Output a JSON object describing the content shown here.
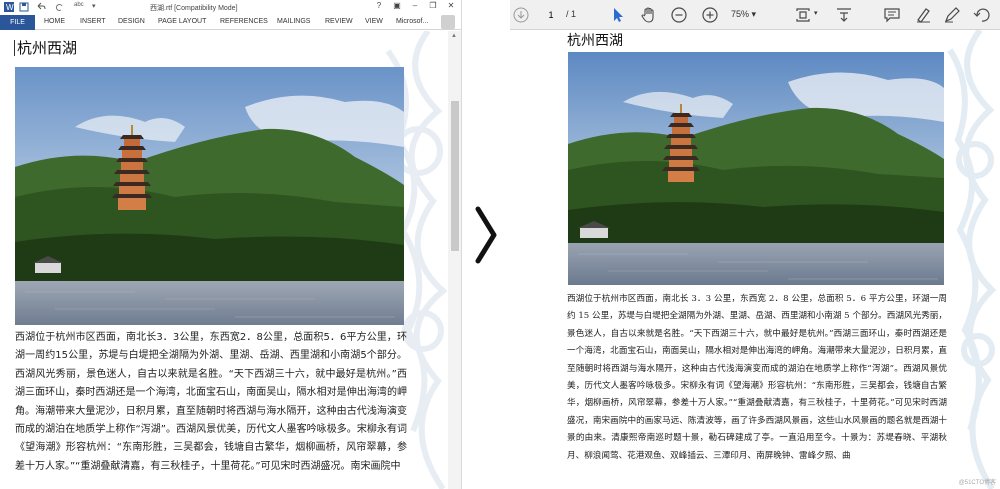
{
  "word": {
    "title": "西湖.rtf [Compatibility Mode]",
    "window_controls": [
      "?",
      "–",
      "❐",
      "✕"
    ],
    "tabs": [
      "FILE",
      "HOME",
      "INSERT",
      "DESIGN",
      "PAGE LAYOUT",
      "REFERENCES",
      "MAILINGS",
      "REVIEW",
      "VIEW",
      "Microsof..."
    ],
    "doc_title": "杭州西湖",
    "body": "西湖位于杭州市区西面，南北长3．3公里，东西宽2．8公里，总面积5．6平方公里，环湖一周约15公里，苏堤与白堤把全湖隔为外湖、里湖、岳湖、西里湖和小南湖5个部分。西湖风光秀丽，景色迷人，自古以来就是名胜。“天下西湖三十六，就中最好是杭州。”西湖三面环山，秦时西湖还是一个海湾，北面宝石山，南面吴山，隔水相对是伸出海湾的岬角。海潮带来大量泥沙，日积月累，直至随朝时将西湖与海水隔开，这种由古代浅海演变而成的湖泊在地质学上称作“泻湖”。西湖风景优美，历代文人墨客吟咏极多。宋柳永有词《望海潮》形容杭州：“东南形胜，三吴都会，钱塘自古繁华，烟柳画桥，风帘翠幕，参差十万人家。”“重湖叠献清嘉，有三秋桂子，十里荷花。”可见宋时西湖盛况。南宋画院中"
  },
  "pdf": {
    "page_current": "1",
    "page_total": "/ 1",
    "zoom": "75%",
    "doc_title": "杭州西湖",
    "body": "西湖位于杭州市区西面，南北长 3．3 公里，东西宽 2．8 公里，总面积 5．6 平方公里，环湖一周约 15 公里，苏堤与白堤把全湖隔为外湖、里湖、岳湖、西里湖和小南湖 5 个部分。西湖风光秀丽，景色迷人，自古以来就是名胜。“天下西湖三十六，就中最好是杭州。”西湖三面环山，秦时西湖还是一个海湾，北面宝石山，南面吴山，隔水相对是伸出海湾的岬角。海潮带来大量泥沙，日积月累，直至随朝时将西湖与海水隔开，这种由古代浅海演变而成的湖泊在地质学上称作“泻湖”。西湖风景优美，历代文人墨客吟咏极多。宋柳永有词《望海潮》形容杭州：“东南形胜，三吴都会，钱塘自古繁华，烟柳画桥，风帘翠幕，参差十万人家。”“重湖叠献清嘉，有三秋桂子，十里荷花。”可见宋时西湖盛况，南宋画院中的画家马远、陈清波等，画了许多西湖风景画，这些山水风景画的题名就是西湖十景的由来。清康熙帝南巡时题十景，勒石碑建成了亭。一直沿用至今。十景为：苏堤春晓、平湖秋月、柳浪闻莺、花港观鱼、双峰插云、三潭印月、南屏晚钟、雷峰夕照、曲",
    "watermark": "@51CTO博客"
  },
  "colors": {
    "word_blue": "#2b579a",
    "pdf_toolbar": "#f0f0f0",
    "toolbar_icon": "#4a4a4a",
    "pointer_blue": "#2a6bd1"
  }
}
